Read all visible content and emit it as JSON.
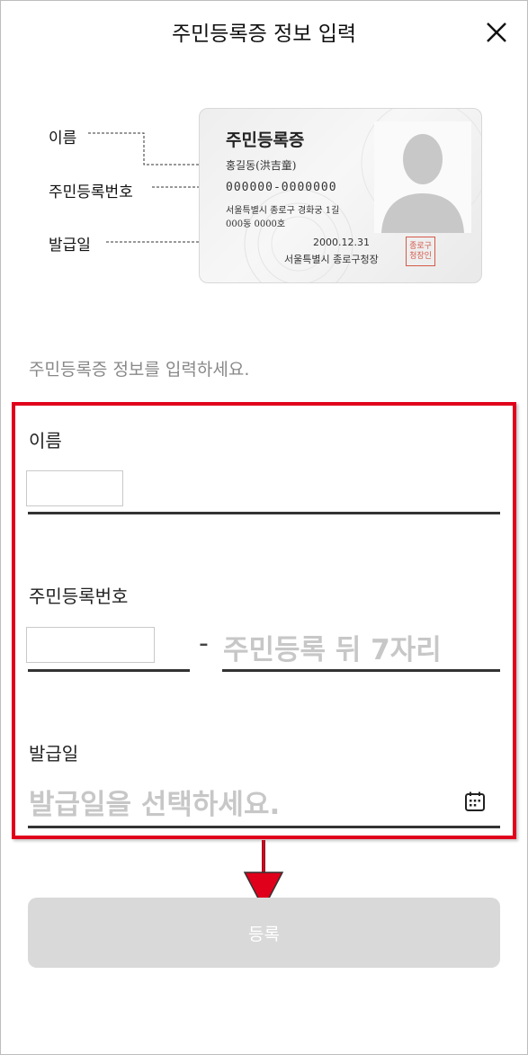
{
  "header": {
    "title": "주민등록증 정보 입력"
  },
  "illustration": {
    "labels": {
      "name": "이름",
      "rrn": "주민등록번호",
      "issue_date": "발급일"
    },
    "card": {
      "title": "주민등록증",
      "holder_name": "홍길동(洪吉童)",
      "rrn": "000000-0000000",
      "address_line1": "서울특별시 종로구 경화궁 1길",
      "address_line2": "000동 0000호",
      "issue_date": "2000.12.31",
      "issuer": "서울특별시 종로구청장",
      "seal_line1": "종로구",
      "seal_line2": "청장인"
    }
  },
  "instruction": "주민등록증 정보를 입력하세요.",
  "form": {
    "name_label": "이름",
    "name_value": "",
    "rrn_label": "주민등록번호",
    "rrn_front_value": "",
    "rrn_back_placeholder": "주민등록 뒤 7자리",
    "rrn_separator": "-",
    "issue_label": "발급일",
    "issue_placeholder": "발급일을 선택하세요."
  },
  "submit_label": "등록",
  "colors": {
    "highlight": "#e0001b",
    "button_disabled": "#d9d9d9",
    "placeholder": "#c7c7c7"
  },
  "icons": {
    "close": "close-icon",
    "calendar": "calendar-icon",
    "arrow": "arrow-down-icon"
  }
}
